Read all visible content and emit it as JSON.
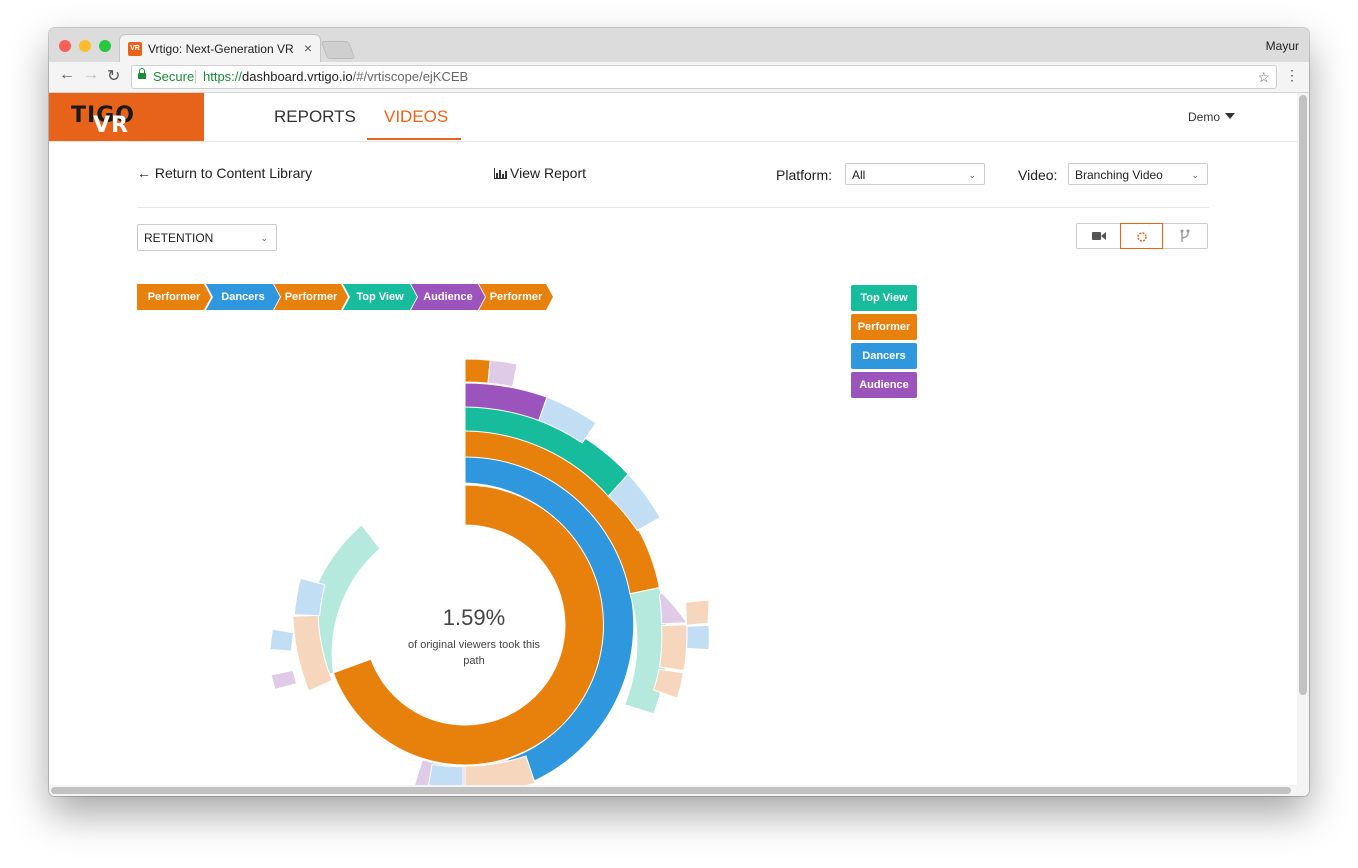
{
  "browser": {
    "tab_title": "Vrtigo: Next-Generation VR An",
    "tab_favicon": "VR",
    "user": "Mayur",
    "secure_label": "Secure",
    "url_protocol": "https://",
    "url_host": "dashboard.vrtigo.io",
    "url_path": "/#/vrtiscope/ejKCEB"
  },
  "nav": {
    "logo_vr": "VR",
    "logo_tigo": "TIGO",
    "reports": "REPORTS",
    "videos": "VIDEOS",
    "account": "Demo"
  },
  "toolbar": {
    "back_label": "Return to Content Library",
    "view_report_label": "View Report",
    "platform_label": "Platform:",
    "platform_value": "All",
    "video_label": "Video:",
    "video_value": "Branching Video",
    "metric_value": "RETENTION"
  },
  "colors": {
    "performer": "#e8800c",
    "dancers": "#2f97dd",
    "top_view": "#16bc9c",
    "audience": "#9b54bb",
    "brand": "#e8631a"
  },
  "path": [
    {
      "label": "Performer",
      "key": "performer"
    },
    {
      "label": "Dancers",
      "key": "dancers"
    },
    {
      "label": "Performer",
      "key": "performer"
    },
    {
      "label": "Top View",
      "key": "top_view"
    },
    {
      "label": "Audience",
      "key": "audience"
    },
    {
      "label": "Performer",
      "key": "performer"
    }
  ],
  "legend": [
    {
      "label": "Top View",
      "key": "top_view"
    },
    {
      "label": "Performer",
      "key": "performer"
    },
    {
      "label": "Dancers",
      "key": "dancers"
    },
    {
      "label": "Audience",
      "key": "audience"
    }
  ],
  "summary": {
    "percent": "1.59%",
    "caption": "of original viewers took this path"
  },
  "view_buttons": [
    "video-camera-icon",
    "sunburst-icon",
    "branch-icon"
  ]
}
